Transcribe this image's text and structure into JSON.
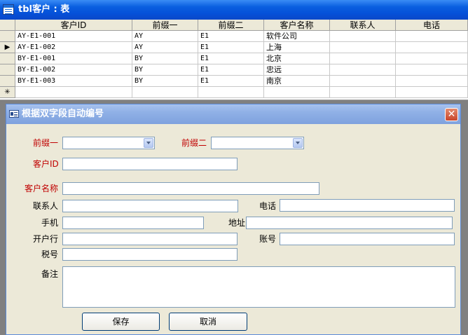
{
  "window": {
    "title": "tbl客户 : 表"
  },
  "table": {
    "columns": [
      "客户ID",
      "前缀一",
      "前缀二",
      "客户名称",
      "联系人",
      "电话"
    ],
    "rows": [
      {
        "selector": "",
        "cells": [
          "AY-E1-001",
          "AY",
          "E1",
          "软件公司",
          "",
          ""
        ]
      },
      {
        "selector": "▶",
        "cells": [
          "AY-E1-002",
          "AY",
          "E1",
          "上海",
          "",
          ""
        ]
      },
      {
        "selector": "",
        "cells": [
          "BY-E1-001",
          "BY",
          "E1",
          "北京",
          "",
          ""
        ]
      },
      {
        "selector": "",
        "cells": [
          "BY-E1-002",
          "BY",
          "E1",
          "忠远",
          "",
          ""
        ]
      },
      {
        "selector": "",
        "cells": [
          "BY-E1-003",
          "BY",
          "E1",
          "南京",
          "",
          ""
        ]
      }
    ],
    "new_row_marker": "✳"
  },
  "dialog": {
    "title": "根据双字段自动编号",
    "close_label": "✕",
    "labels": {
      "prefix1": "前缀一",
      "prefix2": "前缀二",
      "customer_id": "客户ID",
      "customer_name": "客户名称",
      "contact": "联系人",
      "phone": "电话",
      "mobile": "手机",
      "address": "地址",
      "bank": "开户行",
      "account": "账号",
      "tax_no": "税号",
      "notes": "备注"
    },
    "values": {
      "prefix1": "",
      "prefix2": "",
      "customer_id": "",
      "customer_name": "",
      "contact": "",
      "phone": "",
      "mobile": "",
      "address": "",
      "bank": "",
      "account": "",
      "tax_no": "",
      "notes": ""
    },
    "buttons": {
      "save": "保存",
      "cancel": "取消"
    }
  },
  "colors": {
    "required_label": "#c00000",
    "title_bar": "#0a5fe0",
    "dialog_bg": "#ece9d8"
  }
}
